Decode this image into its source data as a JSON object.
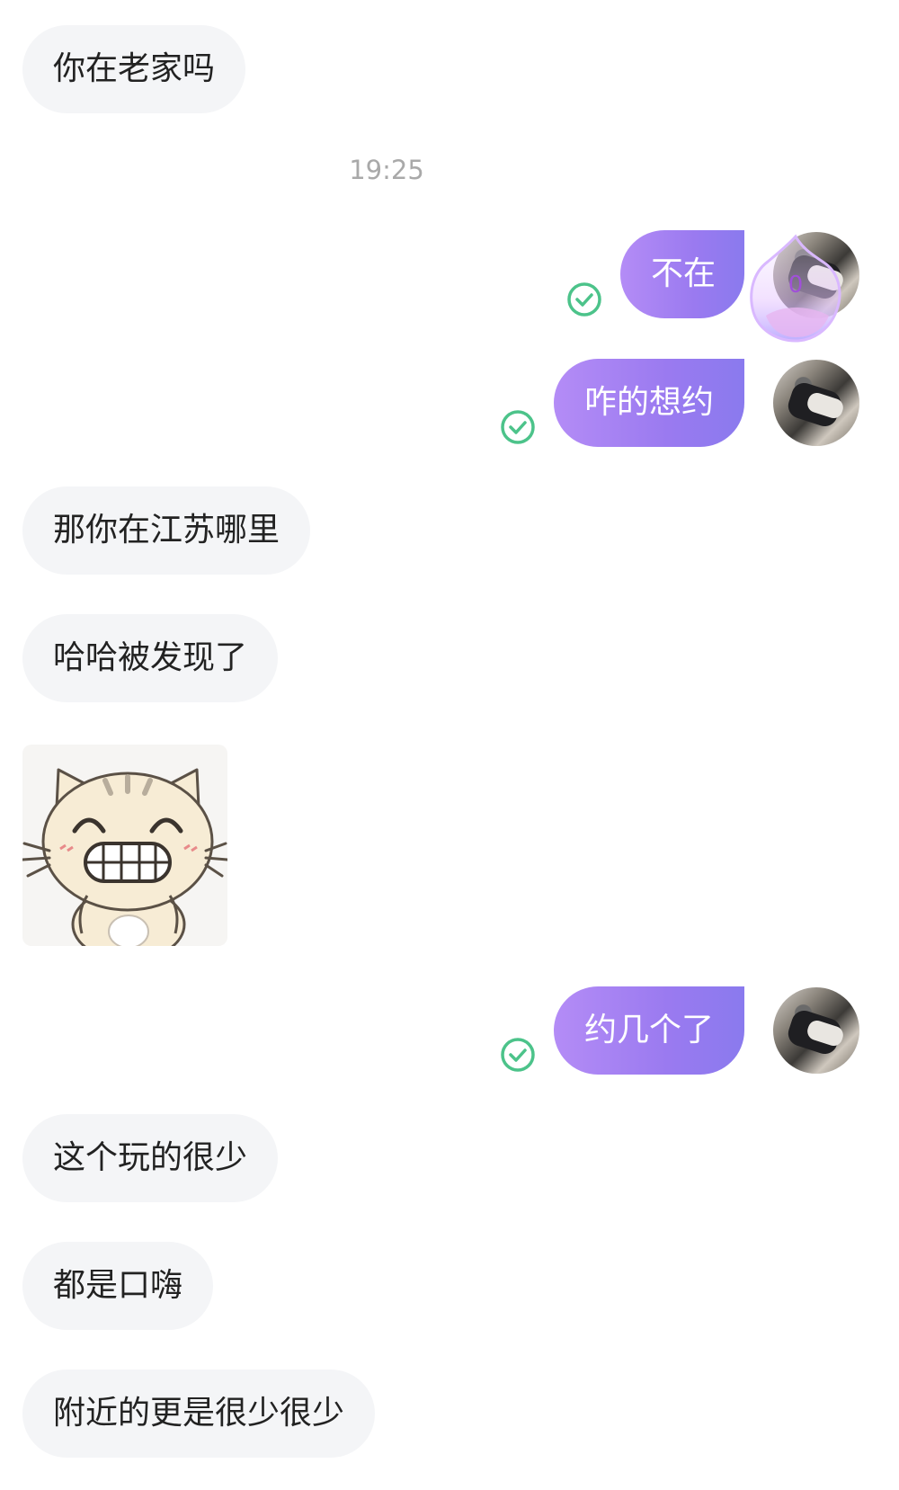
{
  "timestamp": "19:25",
  "messages": {
    "m1": "你在老家吗",
    "m2": "不在",
    "m3": "咋的想约",
    "m4": "那你在江苏哪里",
    "m5": "哈哈被发现了",
    "m6": "约几个了",
    "m7": "这个玩的很少",
    "m8": "都是口嗨",
    "m9": "附近的更是很少很少"
  },
  "pendant_badge": "0",
  "colors": {
    "outgoing_bubble_start": "#b48cf6",
    "outgoing_bubble_end": "#8a7aee",
    "incoming_bubble": "#f4f5f7",
    "read_check": "#4cc38a",
    "timestamp": "#a9a9a9"
  },
  "icons": {
    "read_receipt": "check-circle-icon",
    "sticker": "laughing-cat-sticker"
  }
}
